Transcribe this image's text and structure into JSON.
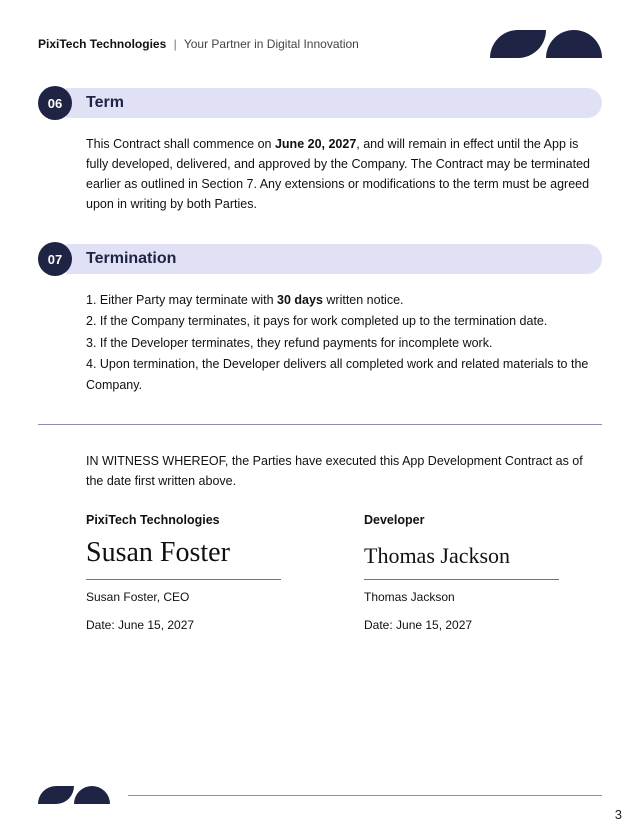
{
  "header": {
    "company": "PixiTech Technologies",
    "divider": "|",
    "tagline": "Your Partner in Digital Innovation"
  },
  "sections": {
    "s6": {
      "num": "06",
      "title": "Term",
      "body_pre": "This Contract shall commence on ",
      "body_strong": "June 20, 2027",
      "body_post": ", and will remain in effect until the App is fully developed, delivered, and approved by the Company. The Contract may be terminated earlier as outlined in Section 7. Any extensions or modifications to the term must be agreed upon in writing by both Parties."
    },
    "s7": {
      "num": "07",
      "title": "Termination",
      "items": {
        "i1_pre": "1. Either Party may terminate with ",
        "i1_strong": "30 days",
        "i1_post": " written notice.",
        "i2": "2. If the Company terminates, it pays for work completed up to the termination date.",
        "i3": "3. If the Developer terminates, they refund payments for incomplete work.",
        "i4": "4. Upon termination, the Developer delivers all completed work and related materials to the Company."
      }
    }
  },
  "witness": "IN WITNESS WHEREOF, the Parties have executed this App Development Contract as of the date first written above.",
  "signatures": {
    "party1": {
      "label": "PixiTech Technologies",
      "signature": "Susan Foster",
      "name": "Susan Foster, CEO",
      "date": "Date: June  15, 2027"
    },
    "party2": {
      "label": "Developer",
      "signature": "Thomas Jackson",
      "name": "Thomas Jackson",
      "date": "Date: June  15, 2027"
    }
  },
  "page": "3"
}
